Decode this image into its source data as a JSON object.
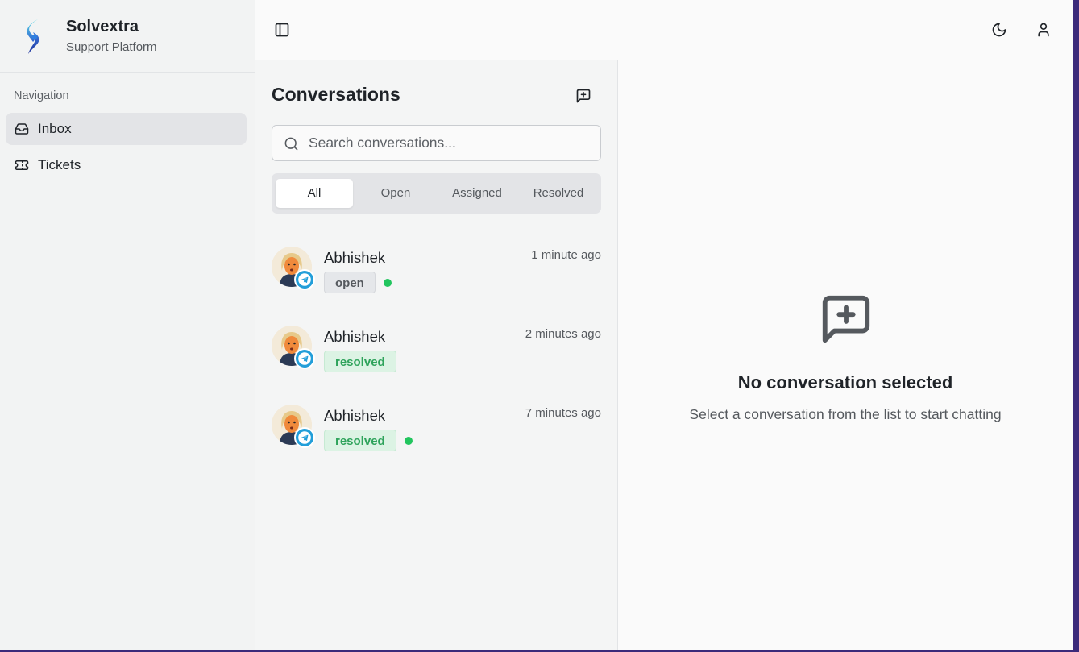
{
  "brand": {
    "name": "Solvextra",
    "subtitle": "Support Platform"
  },
  "sidebar": {
    "heading": "Navigation",
    "items": [
      {
        "label": "Inbox",
        "icon": "inbox-icon",
        "active": true
      },
      {
        "label": "Tickets",
        "icon": "ticket-icon",
        "active": false
      }
    ]
  },
  "topbar": {
    "toggle_icon": "sidebar-toggle-icon",
    "theme_icon": "moon-icon",
    "user_icon": "user-icon"
  },
  "conversations": {
    "title": "Conversations",
    "new_icon": "message-plus-icon",
    "search_placeholder": "Search conversations...",
    "tabs": [
      "All",
      "Open",
      "Assigned",
      "Resolved"
    ],
    "active_tab": "All",
    "items": [
      {
        "name": "Abhishek",
        "time": "1 minute ago",
        "status": "open",
        "online": true,
        "channel": "telegram"
      },
      {
        "name": "Abhishek",
        "time": "2 minutes ago",
        "status": "resolved",
        "online": false,
        "channel": "telegram"
      },
      {
        "name": "Abhishek",
        "time": "7 minutes ago",
        "status": "resolved",
        "online": true,
        "channel": "telegram"
      }
    ]
  },
  "detail": {
    "title": "No conversation selected",
    "subtitle": "Select a conversation from the list to start chatting"
  },
  "colors": {
    "accent_online": "#22c55e",
    "resolved_text": "#2ea35b",
    "telegram": "#229ed9"
  }
}
